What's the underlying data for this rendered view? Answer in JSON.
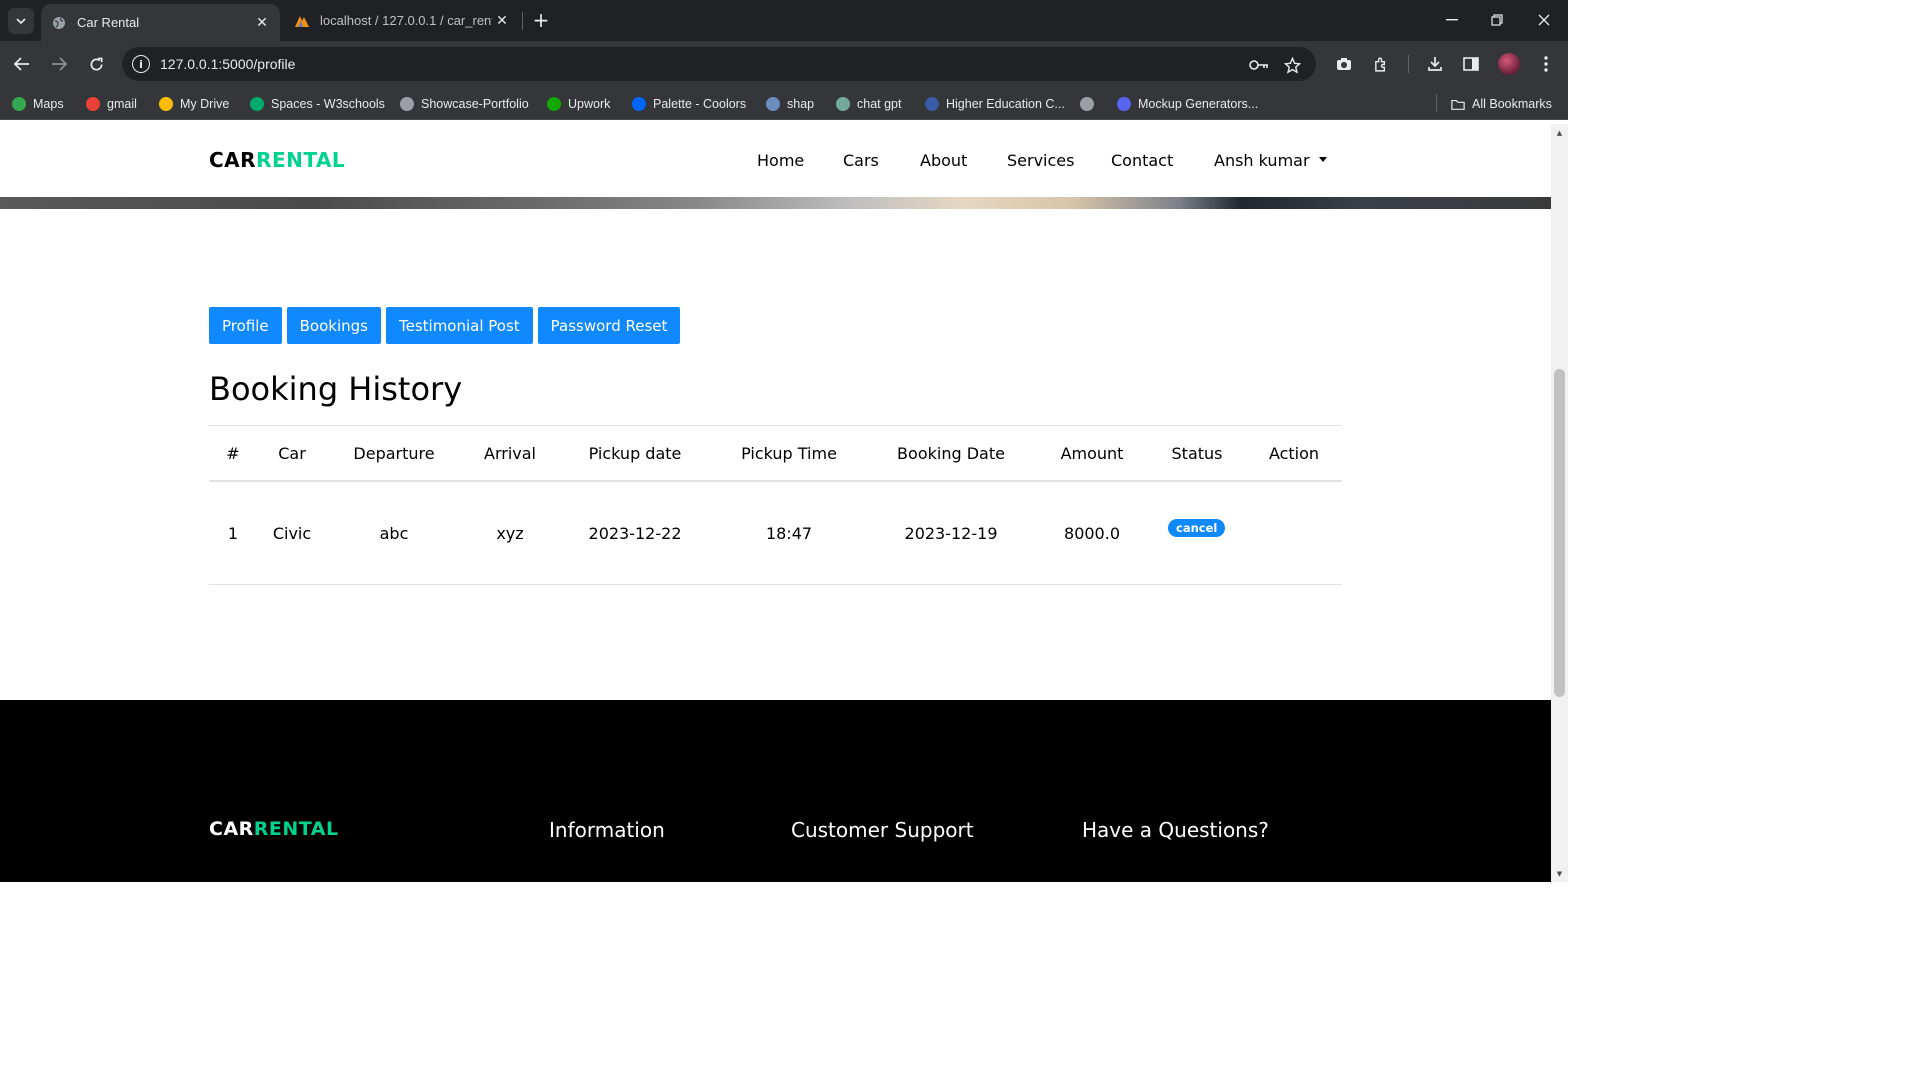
{
  "browser": {
    "tabs": [
      {
        "title": "Car Rental",
        "active": true
      },
      {
        "title": "localhost / 127.0.0.1 / car_rental",
        "active": false
      }
    ],
    "url": "127.0.0.1:5000/profile",
    "bookmarks": [
      {
        "label": "Maps",
        "icon": "maps-icon",
        "color": "#34a853"
      },
      {
        "label": "gmail",
        "icon": "gmail-icon",
        "color": "#ea4335"
      },
      {
        "label": "My Drive",
        "icon": "drive-icon",
        "color": "#fbbc04"
      },
      {
        "label": "Spaces - W3schools",
        "icon": "w3schools-icon",
        "color": "#04aa6d"
      },
      {
        "label": "Showcase-Portfolio",
        "icon": "globe-icon",
        "color": "#9aa0a6"
      },
      {
        "label": "Upwork",
        "icon": "upwork-icon",
        "color": "#14a800"
      },
      {
        "label": "Palette - Coolors",
        "icon": "coolors-icon",
        "color": "#0066ff"
      },
      {
        "label": "shap",
        "icon": "shap-icon",
        "color": "#6c8ebf"
      },
      {
        "label": "chat gpt",
        "icon": "chatgpt-icon",
        "color": "#74aa9c"
      },
      {
        "label": "Higher Education C...",
        "icon": "education-icon",
        "color": "#3b5ba5"
      },
      {
        "label": "",
        "icon": "globe-icon",
        "color": "#9aa0a6"
      },
      {
        "label": "Mockup Generators...",
        "icon": "mockup-icon",
        "color": "#5865f2"
      }
    ],
    "all_bookmarks": "All Bookmarks"
  },
  "site": {
    "logo_part1": "CAR",
    "logo_part2": "RENTAL",
    "nav": [
      "Home",
      "Cars",
      "About",
      "Services",
      "Contact"
    ],
    "user_menu": "Ansh kumar",
    "accent_color": "#1089ff",
    "brand_green": "#01d28e"
  },
  "profile_tabs": [
    "Profile",
    "Bookings",
    "Testimonial Post",
    "Password Reset"
  ],
  "page_title": "Booking History",
  "table": {
    "headers": [
      "#",
      "Car",
      "Departure",
      "Arrival",
      "Pickup date",
      "Pickup Time",
      "Booking Date",
      "Amount",
      "Status",
      "Action"
    ],
    "rows": [
      {
        "num": "1",
        "car": "Civic",
        "departure": "abc",
        "arrival": "xyz",
        "pickup_date": "2023-12-22",
        "pickup_time": "18:47",
        "booking_date": "2023-12-19",
        "amount": "8000.0",
        "status": "cancel",
        "action": ""
      }
    ]
  },
  "footer": {
    "headings": [
      "Information",
      "Customer Support",
      "Have a Questions?"
    ]
  }
}
